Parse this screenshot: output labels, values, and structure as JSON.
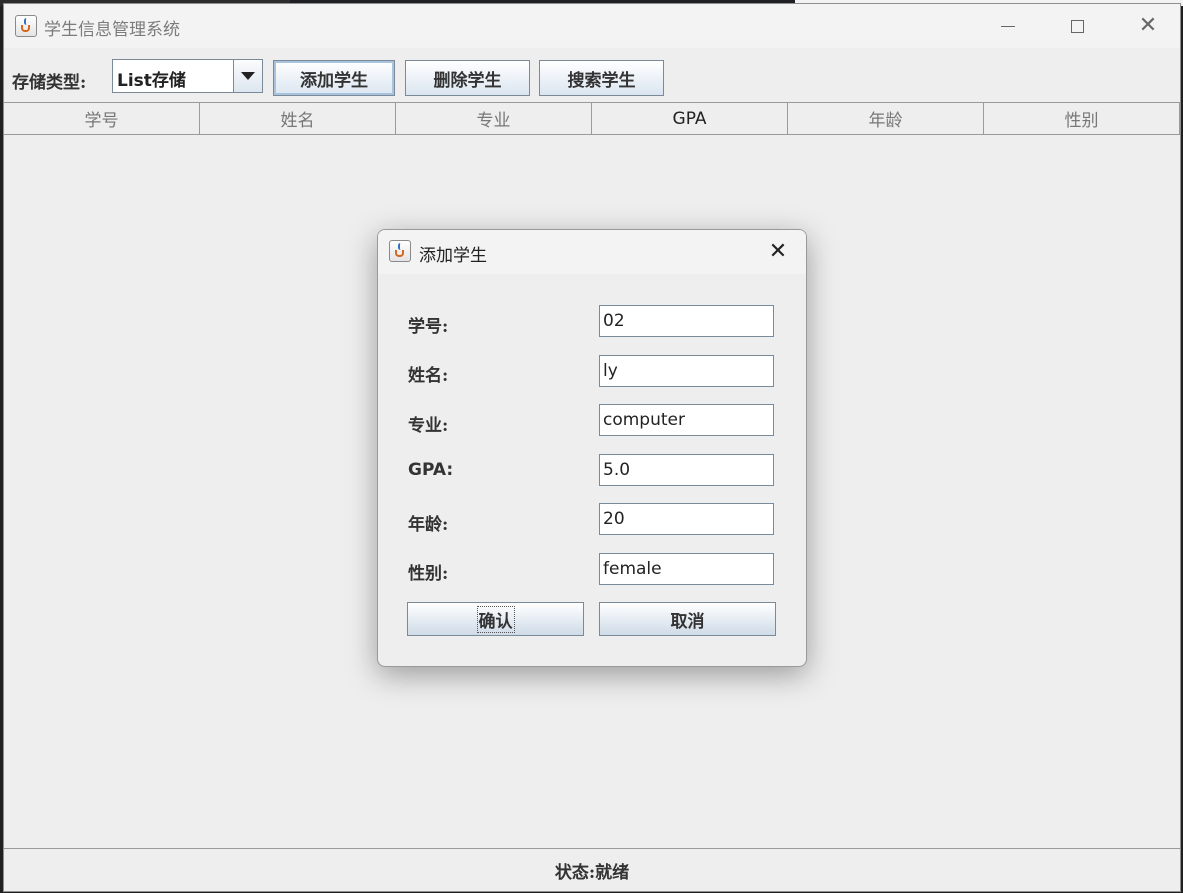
{
  "window": {
    "title": "学生信息管理系统",
    "icon": "java-icon"
  },
  "toolbar": {
    "storage_label": "存储类型:",
    "storage_value": "List存储",
    "add_label": "添加学生",
    "delete_label": "删除学生",
    "search_label": "搜索学生"
  },
  "table": {
    "columns": [
      "学号",
      "姓名",
      "专业",
      "GPA",
      "年龄",
      "性别"
    ],
    "rows": []
  },
  "status": {
    "text": "状态:就绪"
  },
  "dialog": {
    "title": "添加学生",
    "fields": [
      {
        "label": "学号:",
        "value": "02"
      },
      {
        "label": "姓名:",
        "value": "ly"
      },
      {
        "label": "专业:",
        "value": "computer"
      },
      {
        "label": "GPA:",
        "value": "5.0"
      },
      {
        "label": "年龄:",
        "value": "20"
      },
      {
        "label": "性别:",
        "value": "female"
      }
    ],
    "confirm_label": "确认",
    "cancel_label": "取消"
  },
  "colors": {
    "window_bg": "#eeeeee",
    "button_gradient_bottom": "#dbe5f0",
    "border": "#7a8a99"
  }
}
